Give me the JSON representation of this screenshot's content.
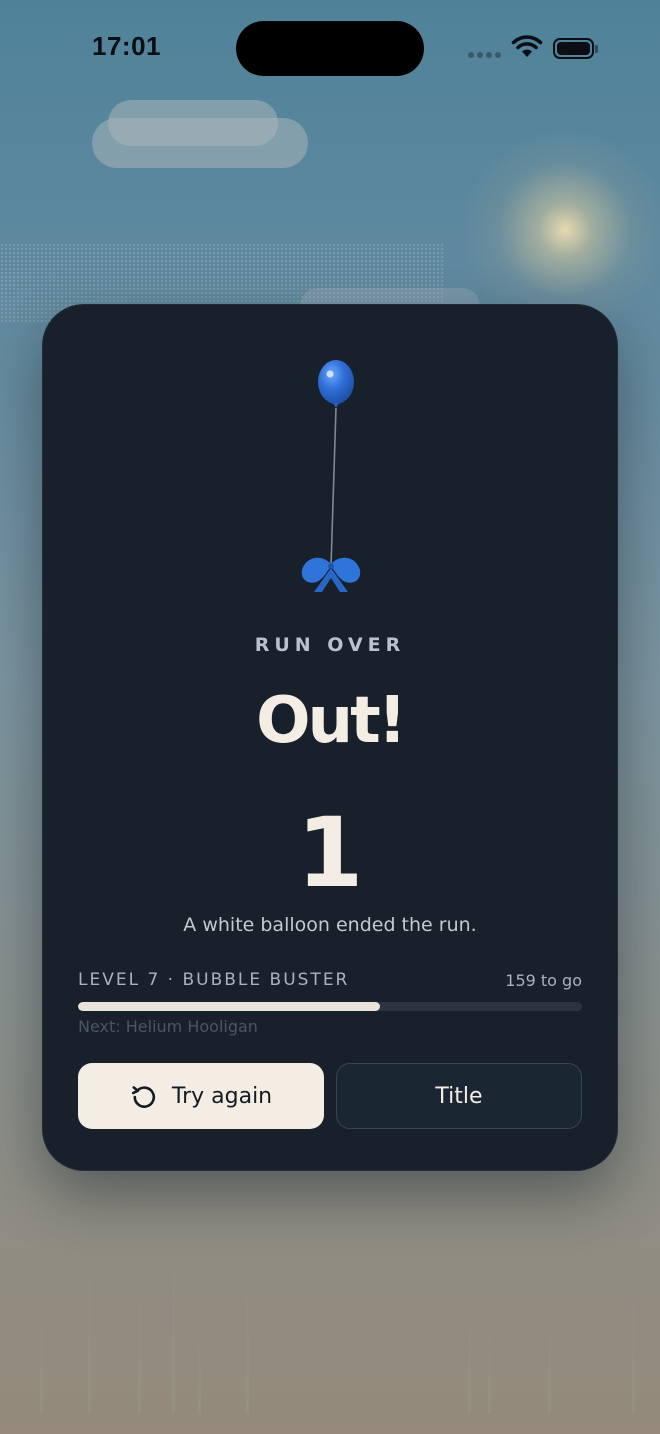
{
  "status_bar": {
    "time": "17:01"
  },
  "card": {
    "kicker": "RUN OVER",
    "headline": "Out!",
    "score": "1",
    "reason": "A white balloon ended the run.",
    "level": {
      "name": "LEVEL 7 · BUBBLE BUSTER",
      "remaining": "159 to go",
      "progress_fraction": 0.6,
      "next": "Next: Helium Hooligan"
    },
    "buttons": {
      "retry_label": "Try again",
      "retry_icon": "retry-icon",
      "title_label": "Title"
    }
  },
  "colors": {
    "card_bg": "#17202b",
    "text_light": "#f3ede4",
    "balloon_blue": "#2f6fd6"
  }
}
